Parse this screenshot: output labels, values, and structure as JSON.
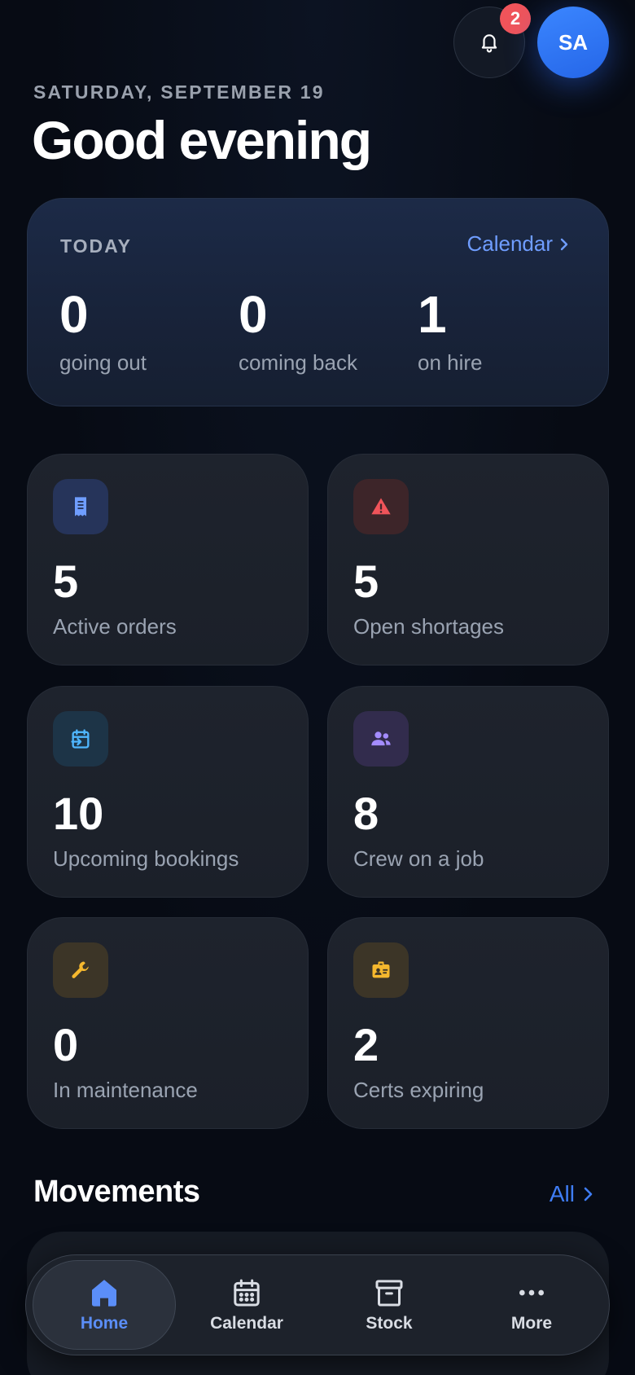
{
  "header": {
    "notification_count": "2",
    "avatar_initials": "SA",
    "date": "SATURDAY, SEPTEMBER 19",
    "greeting": "Good evening"
  },
  "today": {
    "label": "TODAY",
    "calendar_link": "Calendar",
    "stats": [
      {
        "value": "0",
        "label": "going out"
      },
      {
        "value": "0",
        "label": "coming back"
      },
      {
        "value": "1",
        "label": "on hire"
      }
    ]
  },
  "tiles": [
    {
      "value": "5",
      "label": "Active orders",
      "icon": "receipt-icon",
      "color": "#6f9dff"
    },
    {
      "value": "5",
      "label": "Open shortages",
      "icon": "warning-icon",
      "color": "#f0545a"
    },
    {
      "value": "10",
      "label": "Upcoming bookings",
      "icon": "calendar-arrow-icon",
      "color": "#4fb6ff"
    },
    {
      "value": "8",
      "label": "Crew on a job",
      "icon": "people-icon",
      "color": "#a48cff"
    },
    {
      "value": "0",
      "label": "In maintenance",
      "icon": "wrench-icon",
      "color": "#f5b82e"
    },
    {
      "value": "2",
      "label": "Certs expiring",
      "icon": "id-badge-icon",
      "color": "#f5b82e"
    }
  ],
  "movements": {
    "title": "Movements",
    "all_link": "All"
  },
  "tabbar": {
    "tabs": [
      {
        "label": "Home",
        "icon": "home-icon",
        "active": true
      },
      {
        "label": "Calendar",
        "icon": "calendar-icon",
        "active": false
      },
      {
        "label": "Stock",
        "icon": "archive-box-icon",
        "active": false
      },
      {
        "label": "More",
        "icon": "more-dots-icon",
        "active": false
      }
    ]
  },
  "colors": {
    "accent": "#3f7df5",
    "background": "#070b14",
    "badge": "#f0545a"
  }
}
